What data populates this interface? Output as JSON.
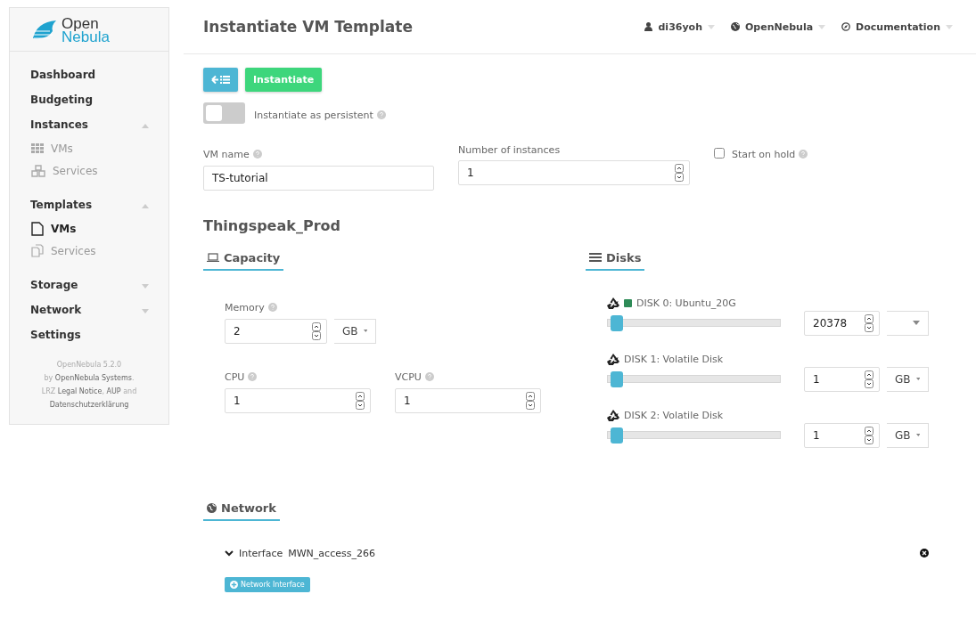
{
  "logo": {
    "line1": "Open",
    "line2": "Nebula"
  },
  "sidebar": {
    "items": [
      {
        "label": "Dashboard",
        "selected": false
      },
      {
        "label": "Budgeting",
        "selected": false
      },
      {
        "label": "Instances",
        "selected": false,
        "expanded": true,
        "children": [
          {
            "label": "VMs",
            "selected": false
          },
          {
            "label": "Services",
            "selected": false
          }
        ]
      },
      {
        "label": "Templates",
        "selected": false,
        "expanded": true,
        "children": [
          {
            "label": "VMs",
            "selected": true
          },
          {
            "label": "Services",
            "selected": false
          }
        ]
      },
      {
        "label": "Storage",
        "selected": false,
        "expanded": false
      },
      {
        "label": "Network",
        "selected": false,
        "expanded": false
      },
      {
        "label": "Settings",
        "selected": false
      }
    ],
    "footer": [
      "OpenNebula 5.2.0",
      "by **OpenNebula Systems**.",
      "LRZ **Legal Notice**, **AUP** and",
      "**Datenschutzerklärung**"
    ]
  },
  "header": {
    "title": "Instantiate VM Template",
    "menus": [
      {
        "label": "di36yoh"
      },
      {
        "label": "OpenNebula"
      },
      {
        "label": "Documentation"
      }
    ]
  },
  "actions": {
    "instantiate": "Instantiate"
  },
  "persistent": {
    "label": "Instantiate as persistent",
    "on": false
  },
  "vm_name": {
    "label": "VM name",
    "value": "TS-tutorial"
  },
  "instances": {
    "label": "Number of instances",
    "value": "1"
  },
  "hold": {
    "label": "Start on hold",
    "checked": false
  },
  "template_name": "Thingspeak_Prod",
  "capacity": {
    "title": "Capacity",
    "memory": {
      "label": "Memory",
      "value": "2",
      "unit": "GB"
    },
    "cpu": {
      "label": "CPU",
      "value": "1"
    },
    "vcpu": {
      "label": "VCPU",
      "value": "1"
    }
  },
  "disks": {
    "title": "Disks",
    "items": [
      {
        "label": "DISK 0: Ubuntu_20G",
        "color": "#2e8b57",
        "level": 0.02,
        "value": "20378"
      },
      {
        "label": "DISK 1: Volatile Disk",
        "level": 0.02,
        "value": "1",
        "unit": "GB"
      },
      {
        "label": "DISK 2: Volatile Disk",
        "level": 0.02,
        "value": "1",
        "unit": "GB"
      }
    ]
  },
  "network": {
    "title": "Network",
    "interfaces": [
      {
        "label": "Interface",
        "name": "MWN_access_266",
        "expanded": true
      }
    ],
    "add": "Network Interface"
  }
}
